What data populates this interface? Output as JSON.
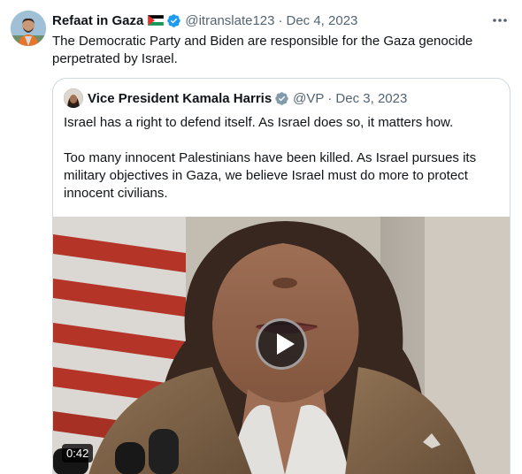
{
  "tweet": {
    "author_name": "Refaat in Gaza",
    "handle": "@itranslate123",
    "separator": "·",
    "date": "Dec 4, 2023",
    "text": "The Democratic Party and Biden are responsible for the Gaza genocide perpetrated by Israel.",
    "more_icon": "more-horizontal-icon",
    "verified_icon": "verified-badge-icon",
    "flag_icon": "palestine-flag-icon"
  },
  "quoted_tweet": {
    "author_name": "Vice President Kamala Harris",
    "handle": "@VP",
    "separator": "·",
    "date": "Dec 3, 2023",
    "paragraph_1": "Israel has a right to defend itself. As Israel does so, it matters how.",
    "paragraph_2": "Too many innocent Palestinians have been killed. As Israel pursues its military objectives in Gaza, we believe Israel must do more to protect innocent civilians.",
    "verified_icon": "verified-badge-gray-icon",
    "media": {
      "type": "video",
      "duration": "0:42",
      "play_icon": "play-icon"
    }
  },
  "colors": {
    "text_primary": "#0f1419",
    "text_secondary": "#536471",
    "border": "#cfd9de",
    "verified_blue": "#1d9bf0",
    "verified_gray": "#829aab"
  }
}
